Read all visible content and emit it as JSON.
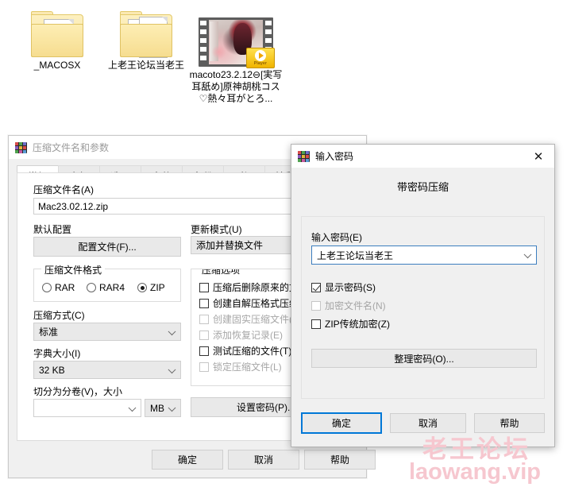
{
  "desktop": {
    "files": [
      {
        "name": "_MACOSX",
        "icon": "folder-icon"
      },
      {
        "name": "上老王论坛当老王",
        "icon": "folder-icon"
      },
      {
        "name": "macoto23.2.12⊖[実写耳舐め]原神胡桃コス♡熱々耳がとろ...",
        "icon": "video-thumbnail-icon",
        "badge": "Player"
      }
    ]
  },
  "main_dialog": {
    "title": "压缩文件名和参数",
    "caption_help": "?",
    "caption_close": "✕",
    "tabs": [
      {
        "label": "常规",
        "selected": true
      },
      {
        "label": "高级",
        "selected": false
      },
      {
        "label": "选项",
        "selected": false
      },
      {
        "label": "文件",
        "selected": false
      },
      {
        "label": "备份",
        "selected": false
      },
      {
        "label": "时间",
        "selected": false
      },
      {
        "label": "注释",
        "selected": false
      }
    ],
    "archive_name_label": "压缩文件名(A)",
    "archive_name_value": "Mac23.02.12.zip",
    "default_profile_label": "默认配置",
    "profile_button": "配置文件(F)...",
    "update_mode_label": "更新模式(U)",
    "update_mode_value": "添加并替换文件",
    "format_group_title": "压缩文件格式",
    "formats": [
      {
        "label": "RAR",
        "selected": false
      },
      {
        "label": "RAR4",
        "selected": false
      },
      {
        "label": "ZIP",
        "selected": true
      }
    ],
    "method_label": "压缩方式(C)",
    "method_value": "标准",
    "dict_label": "字典大小(I)",
    "dict_value": "32 KB",
    "split_label": "切分为分卷(V)，大小",
    "split_value": "",
    "split_unit": "MB",
    "options_group_title": "压缩选项",
    "options": [
      {
        "label": "压缩后删除原来的文件(L)",
        "checked": false,
        "disabled": false
      },
      {
        "label": "创建自解压格式压缩文件(X)",
        "checked": false,
        "disabled": false
      },
      {
        "label": "创建固实压缩文件(S)",
        "checked": false,
        "disabled": true
      },
      {
        "label": "添加恢复记录(E)",
        "checked": false,
        "disabled": true
      },
      {
        "label": "测试压缩的文件(T)",
        "checked": false,
        "disabled": false
      },
      {
        "label": "锁定压缩文件(L)",
        "checked": false,
        "disabled": true
      }
    ],
    "set_password_button": "设置密码(P)...",
    "ok_button": "确定",
    "cancel_button": "取消",
    "help_button": "帮助"
  },
  "password_dialog": {
    "title": "输入密码",
    "caption_close": "✕",
    "heading": "带密码压缩",
    "password_label": "输入密码(E)",
    "password_value": "上老王论坛当老王",
    "checkboxes": [
      {
        "label": "显示密码(S)",
        "checked": true,
        "disabled": false
      },
      {
        "label": "加密文件名(N)",
        "checked": false,
        "disabled": true
      },
      {
        "label": "ZIP传统加密(Z)",
        "checked": false,
        "disabled": false
      }
    ],
    "organize_button": "整理密码(O)...",
    "ok_button": "确定",
    "cancel_button": "取消",
    "help_button": "帮助"
  },
  "watermark": {
    "line1": "老王论坛",
    "line2": "laowang.vip",
    "color": "#f6c7cf"
  }
}
